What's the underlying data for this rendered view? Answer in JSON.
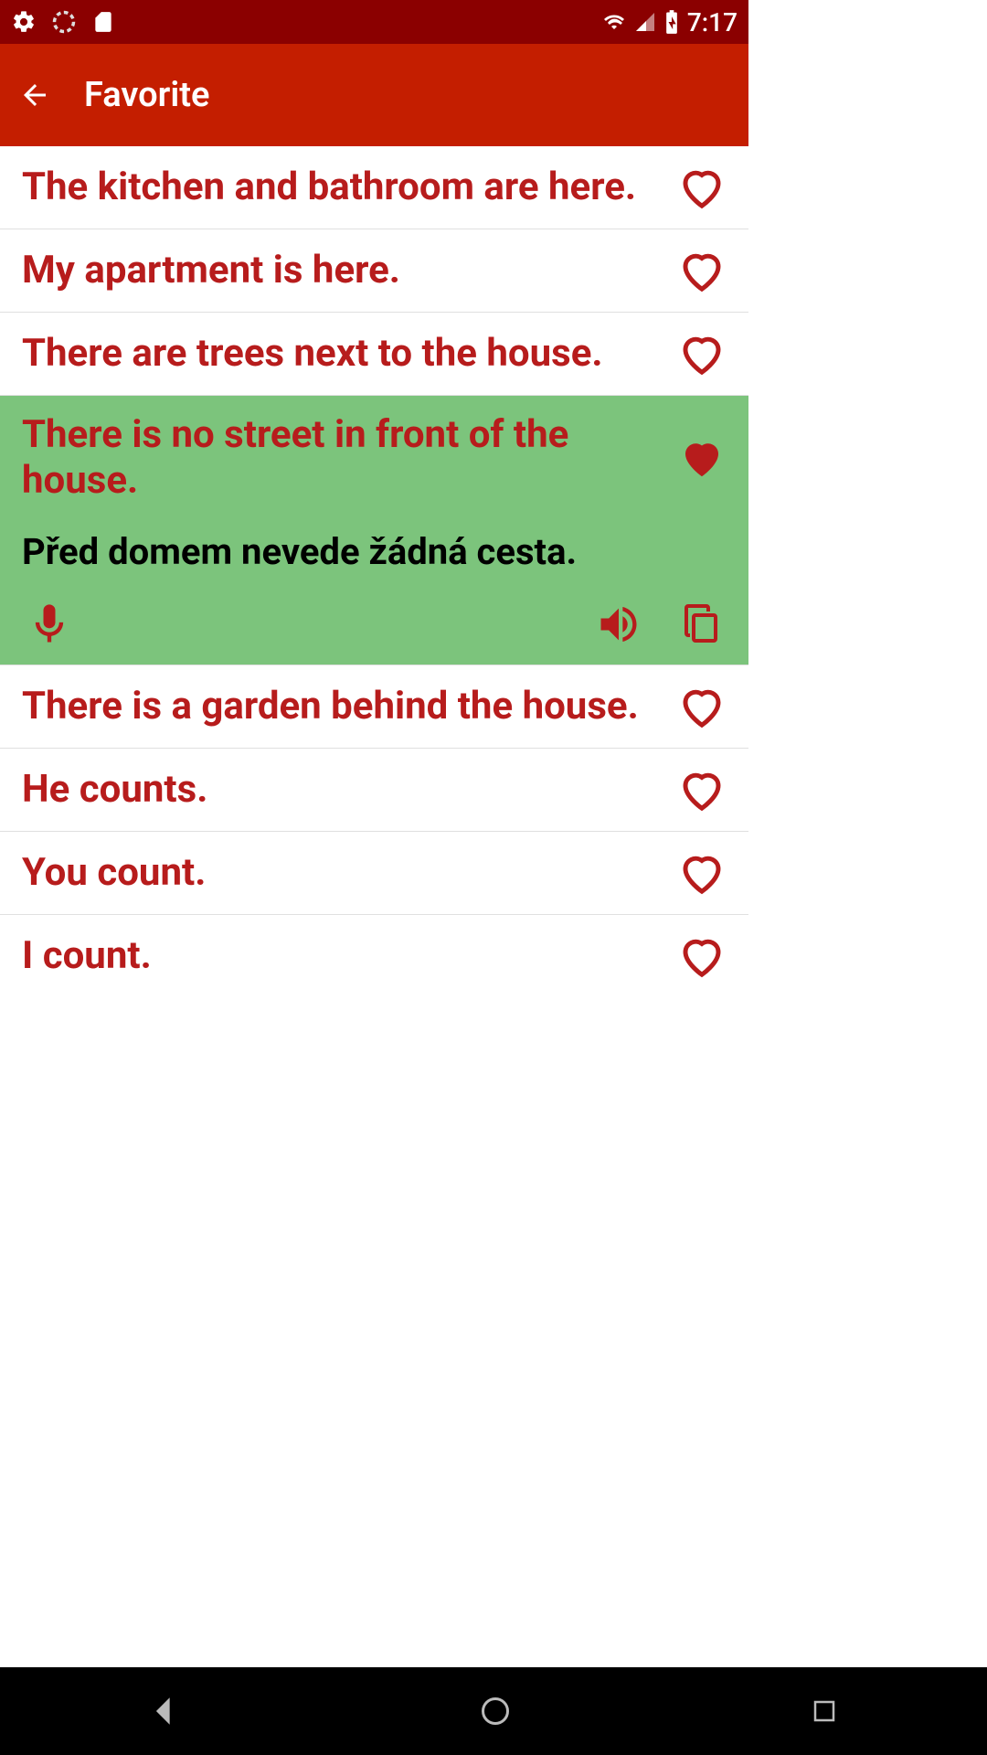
{
  "status": {
    "time": "7:17"
  },
  "appbar": {
    "title": "Favorite"
  },
  "items": [
    {
      "phrase": "The kitchen and bathroom are here.",
      "favorited": false,
      "expanded": false
    },
    {
      "phrase": "My apartment is here.",
      "favorited": false,
      "expanded": false
    },
    {
      "phrase": "There are trees next to the house.",
      "favorited": false,
      "expanded": false
    },
    {
      "phrase": "There is no street in front of the house.",
      "translation": "Před domem nevede žádná cesta.",
      "favorited": true,
      "expanded": true
    },
    {
      "phrase": "There is a garden behind the house.",
      "favorited": false,
      "expanded": false
    },
    {
      "phrase": "He counts.",
      "favorited": false,
      "expanded": false
    },
    {
      "phrase": "You count.",
      "favorited": false,
      "expanded": false
    },
    {
      "phrase": "I count.",
      "favorited": false,
      "expanded": false
    }
  ],
  "colors": {
    "statusBar": "#8b0000",
    "appBar": "#c41e00",
    "text": "#b71c1c",
    "highlight": "#7cc47c"
  }
}
